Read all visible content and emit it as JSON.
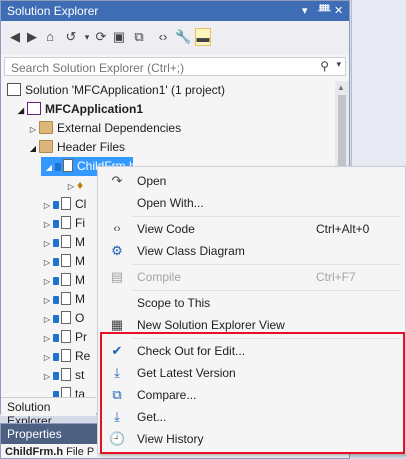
{
  "panel": {
    "title": "Solution Explorer",
    "controls": [
      "▾",
      "ᚙ",
      "✕"
    ],
    "search_placeholder": "Search Solution Explorer (Ctrl+;)",
    "tab_label": "Solution Explorer"
  },
  "tree": {
    "solution": "Solution 'MFCApplication1' (1 project)",
    "project": "MFCApplication1",
    "external": "External Dependencies",
    "header_files": "Header Files",
    "selected": "ChildFrm.h",
    "children": [
      "Cl",
      "Fi",
      "M",
      "M",
      "M",
      "M",
      "O",
      "Pr",
      "Re",
      "st",
      "ta"
    ]
  },
  "properties": {
    "title": "Properties",
    "subject": "ChildFrm.h",
    "subject_suffix": "File P"
  },
  "menu": {
    "items": [
      {
        "label": "Open",
        "icon": "open-arrow-icon"
      },
      {
        "label": "Open With...",
        "icon": ""
      },
      {
        "label": "View Code",
        "shortcut": "Ctrl+Alt+0",
        "icon": "code-icon"
      },
      {
        "label": "View Class Diagram",
        "icon": "class-diagram-icon"
      },
      {
        "label": "Compile",
        "shortcut": "Ctrl+F7",
        "icon": "compile-icon",
        "disabled": true
      },
      {
        "label": "Scope to This",
        "icon": ""
      },
      {
        "label": "New Solution Explorer View",
        "icon": "new-view-icon"
      },
      {
        "label": "Check Out for Edit...",
        "icon": "checkmark-icon"
      },
      {
        "label": "Get Latest Version",
        "icon": "get-latest-icon"
      },
      {
        "label": "Compare...",
        "icon": "compare-icon"
      },
      {
        "label": "Get...",
        "icon": "get-icon"
      },
      {
        "label": "View History",
        "icon": "history-icon"
      }
    ]
  },
  "colors": {
    "title_bar": "#3e6db5",
    "selection": "#3399ff",
    "highlight_box": "#e81123"
  }
}
